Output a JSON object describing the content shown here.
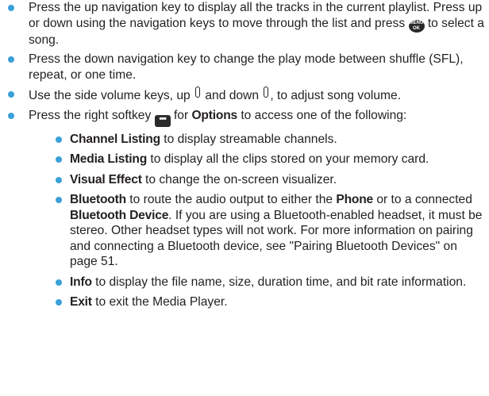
{
  "items": [
    {
      "t1": "Press the up navigation key to display all the tracks in the current playlist. Press up or down using the navigation keys to move through the list and press ",
      "icon": "menu-ok-key-icon",
      "icon_text": "MENU OK",
      "t2": " to select a song."
    },
    {
      "t1": "Press the down navigation key to change the play mode between shuffle (SFL), repeat, or one time."
    },
    {
      "t1": "Use the side volume keys, up ",
      "t2": " and down ",
      "t3": ", to adjust song volume.",
      "icon": "side-volume-key-icon"
    },
    {
      "t1": "Press the right softkey ",
      "icon": "right-softkey-icon",
      "icon_text": "•••",
      "t2": " for ",
      "b1": "Options",
      "t3": " to access one of the following:",
      "sub": [
        {
          "b1": "Channel Listing",
          "t1": " to display streamable channels."
        },
        {
          "b1": "Media Listing",
          "t1": " to display all the clips stored on your memory card."
        },
        {
          "b1": "Visual Effect",
          "t1": " to change the on-screen visualizer."
        },
        {
          "b1": "Bluetooth",
          "t1": " to route the audio output to either the ",
          "b2": "Phone",
          "t2": " or to a connected ",
          "b3": "Bluetooth Device",
          "t3": ". If you are using a Bluetooth-enabled headset, it must be stereo. Other headset types will not work. For more information on pairing and connecting a Bluetooth device, see \"Pairing Bluetooth Devices\" on page 51."
        },
        {
          "b1": "Info",
          "t1": " to display the file name, size, duration time, and bit rate information."
        },
        {
          "b1": "Exit",
          "t1": " to exit the Media Player."
        }
      ]
    }
  ],
  "colors": {
    "bullet": "#3aa0d8",
    "text": "#231f20",
    "icon_bg": "#2a2a2a"
  }
}
